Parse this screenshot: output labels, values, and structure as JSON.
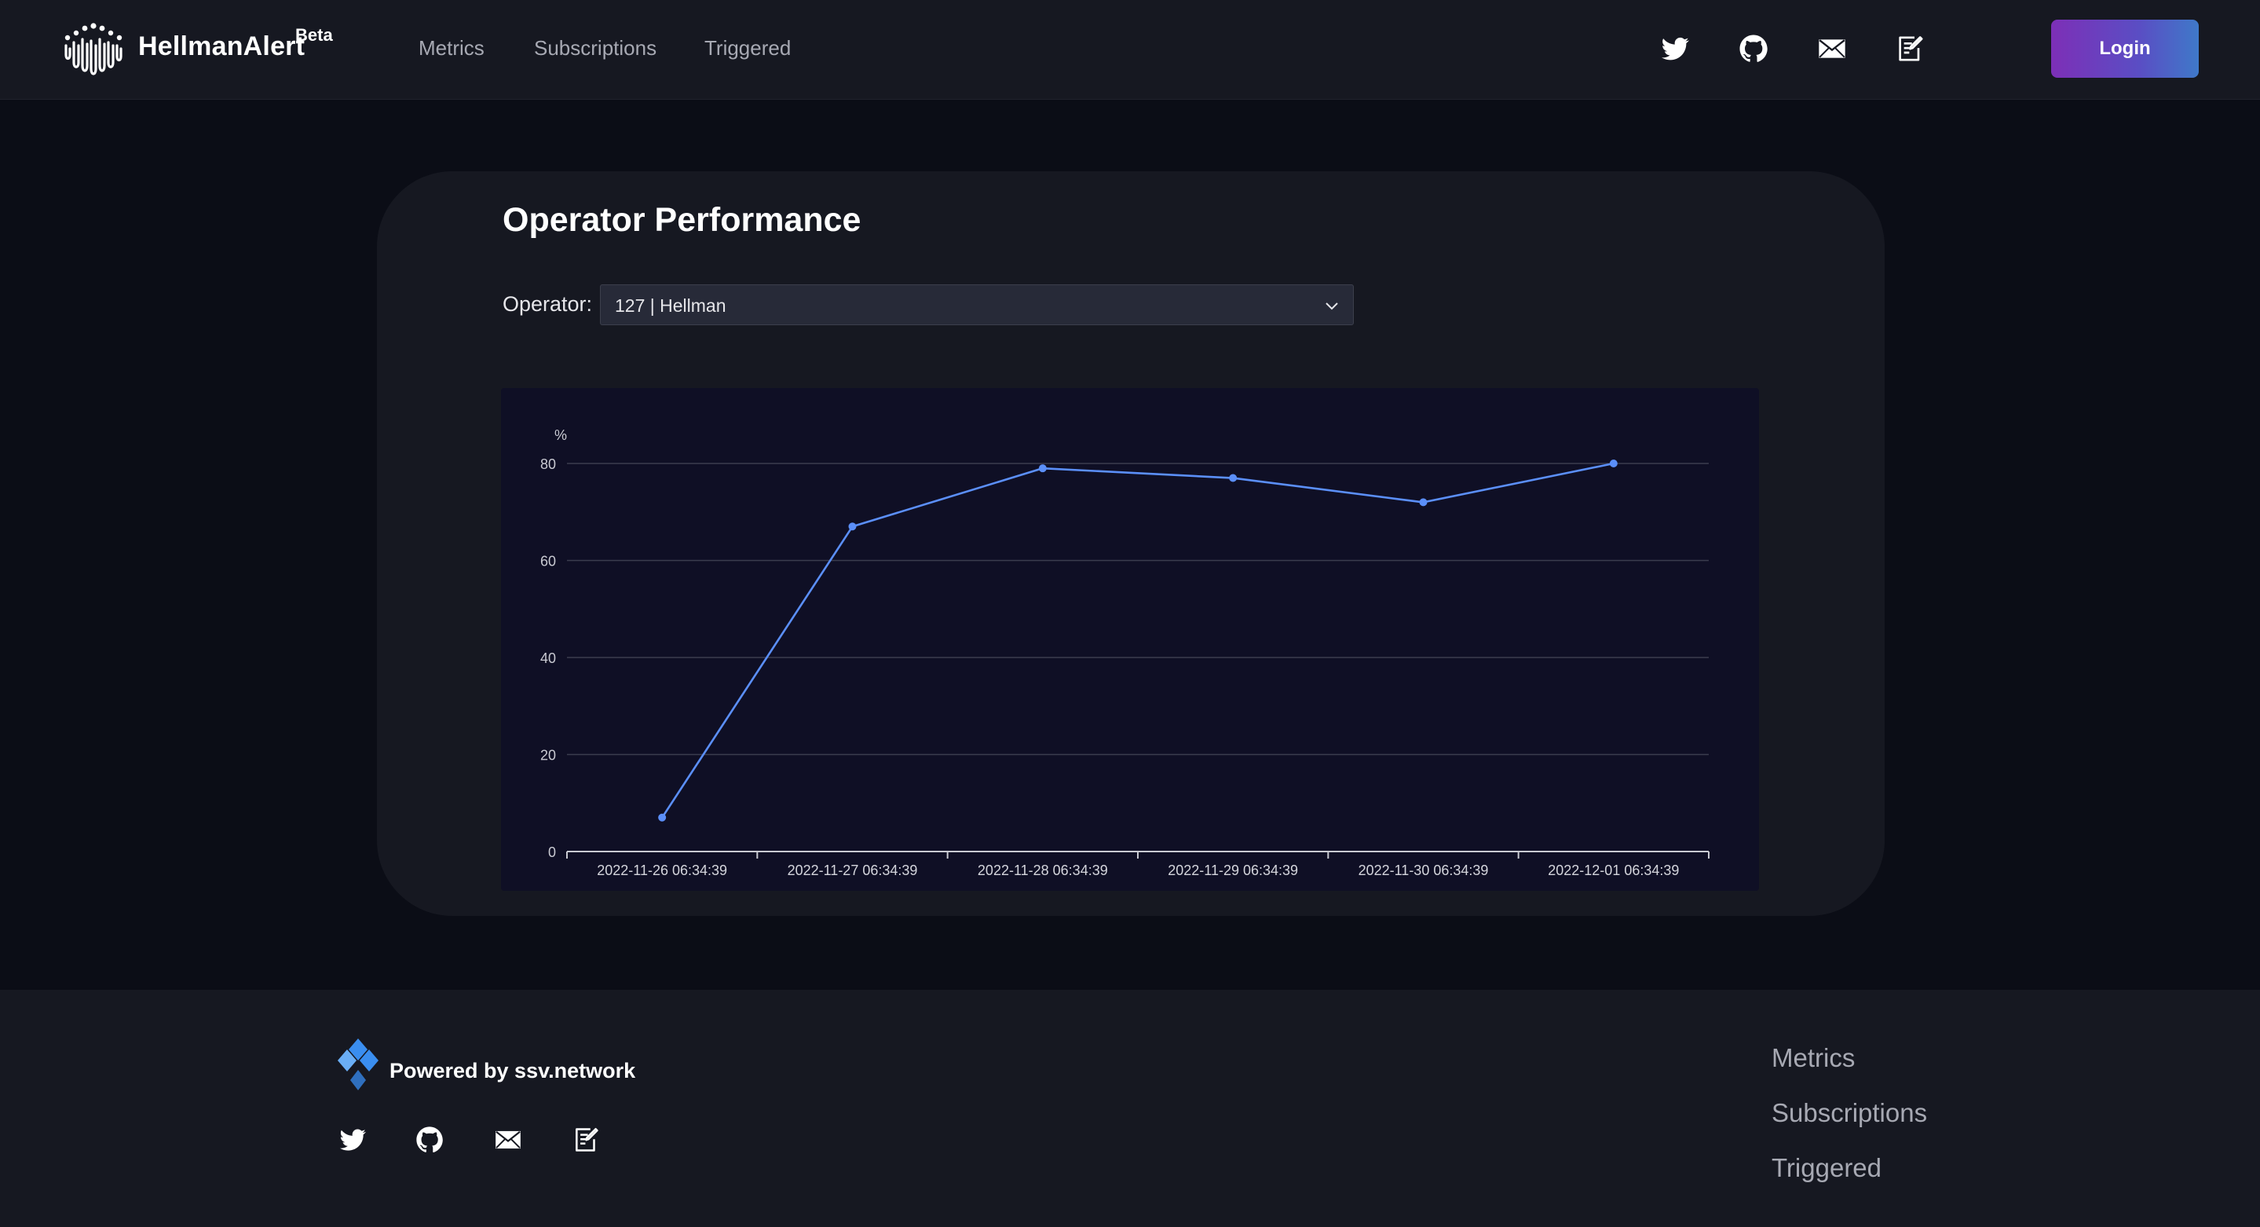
{
  "header": {
    "brand": "HellmanAlert",
    "badge": "Beta",
    "nav": [
      "Metrics",
      "Subscriptions",
      "Triggered"
    ],
    "icons": [
      "twitter-icon",
      "github-icon",
      "mail-icon",
      "notepad-icon"
    ],
    "login_label": "Login"
  },
  "main": {
    "title": "Operator Performance",
    "operator_label": "Operator:",
    "operator_value": "127 | Hellman"
  },
  "chart_data": {
    "type": "line",
    "ylabel": "%",
    "ylim": [
      0,
      80
    ],
    "yticks": [
      0,
      20,
      40,
      60,
      80
    ],
    "x": [
      "2022-11-26 06:34:39",
      "2022-11-27 06:34:39",
      "2022-11-28 06:34:39",
      "2022-11-29 06:34:39",
      "2022-11-30 06:34:39",
      "2022-12-01 06:34:39"
    ],
    "series": [
      {
        "values": [
          7,
          67,
          79,
          77,
          72,
          80
        ]
      }
    ],
    "grid": true,
    "line_color": "#5b8ff9"
  },
  "footer": {
    "powered_by": "Powered by ssv.network",
    "icons": [
      "twitter-icon",
      "github-icon",
      "mail-icon",
      "notepad-icon"
    ],
    "links": [
      "Metrics",
      "Subscriptions",
      "Triggered"
    ]
  },
  "colors": {
    "background": "#0b0d16",
    "panel": "#161821",
    "chart_bg": "#0f0f25",
    "accent_gradient_start": "#7d2fb7",
    "accent_gradient_end": "#3f79c9"
  }
}
